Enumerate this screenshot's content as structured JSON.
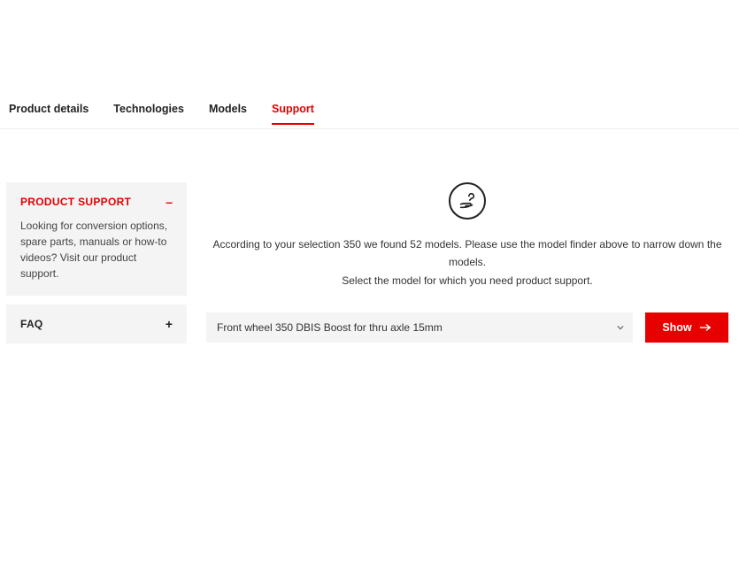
{
  "tabs": {
    "product_details": "Product details",
    "technologies": "Technologies",
    "models": "Models",
    "support": "Support"
  },
  "sidebar": {
    "product_support": {
      "title": "PRODUCT SUPPORT",
      "sign": "–",
      "body": "Looking for conversion options, spare parts, manuals or how-to videos? Visit our product support."
    },
    "faq": {
      "title": "FAQ",
      "sign": "+"
    }
  },
  "content": {
    "help_line1": "According to your selection 350 we found 52 models. Please use the model finder above to narrow down the models.",
    "help_line2": "Select the model for which you need product support."
  },
  "selector": {
    "selected": "Front wheel 350 DBIS Boost for thru axle 15mm",
    "show_label": "Show"
  }
}
